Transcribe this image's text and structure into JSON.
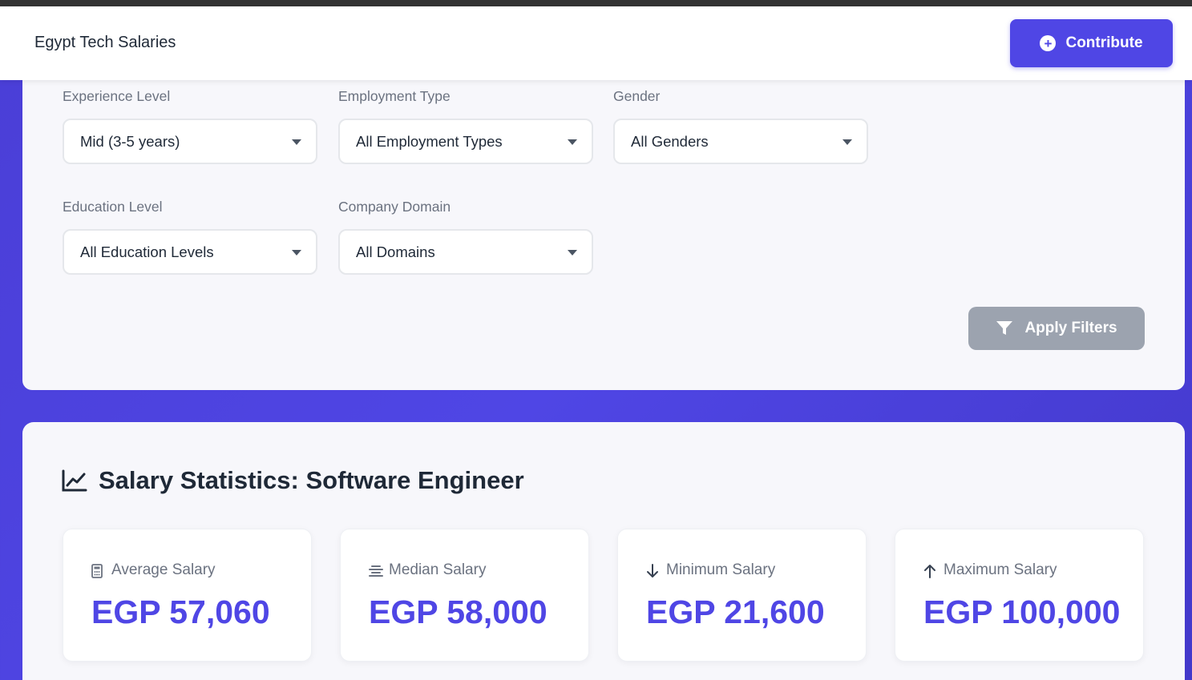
{
  "navbar": {
    "brand": "Egypt Tech Salaries",
    "contribute_label": "Contribute"
  },
  "filters": {
    "experience": {
      "label": "Experience Level",
      "value": "Mid (3-5 years)"
    },
    "employment": {
      "label": "Employment Type",
      "value": "All Employment Types"
    },
    "gender": {
      "label": "Gender",
      "value": "All Genders"
    },
    "education": {
      "label": "Education Level",
      "value": "All Education Levels"
    },
    "domain": {
      "label": "Company Domain",
      "value": "All Domains"
    },
    "apply_label": "Apply Filters"
  },
  "stats": {
    "title": "Salary Statistics: Software Engineer",
    "cards": [
      {
        "label": "Average Salary",
        "value": "EGP 57,060",
        "icon": "calculator-icon"
      },
      {
        "label": "Median Salary",
        "value": "EGP 58,000",
        "icon": "align-center-icon"
      },
      {
        "label": "Minimum Salary",
        "value": "EGP 21,600",
        "icon": "arrow-down-icon"
      },
      {
        "label": "Maximum Salary",
        "value": "EGP 100,000",
        "icon": "arrow-up-icon"
      }
    ]
  },
  "colors": {
    "accent": "#4f46e5",
    "background": "#4f46e5",
    "disabled_button": "#9ca3af"
  }
}
